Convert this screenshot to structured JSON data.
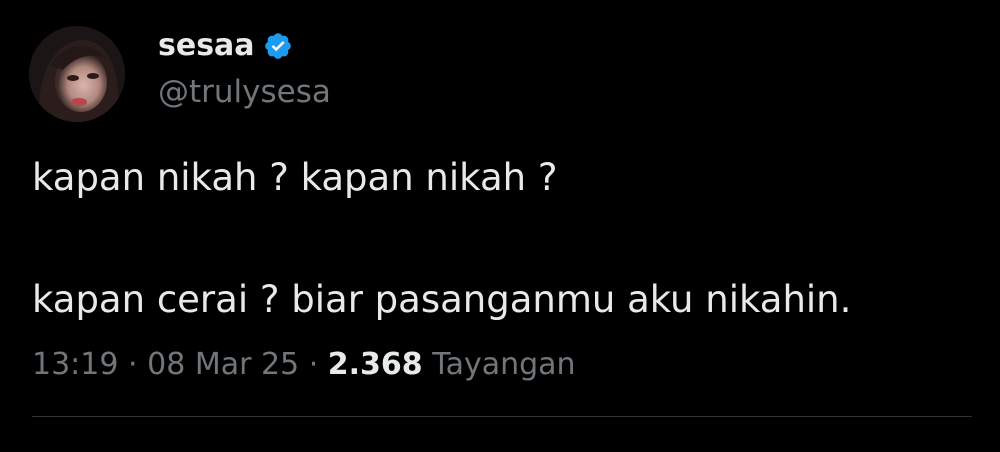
{
  "user": {
    "display_name": "sesaa",
    "handle": "@trulysesa",
    "verified": true
  },
  "tweet": {
    "line1": "kapan nikah ? kapan nikah ?",
    "line2": "kapan cerai ? biar pasanganmu aku nikahin."
  },
  "meta": {
    "time": "13:19",
    "separator": "·",
    "date": "08 Mar 25",
    "views_count": "2.368",
    "views_label": "Tayangan"
  },
  "icons": {
    "verified": "verified-badge-icon"
  },
  "colors": {
    "background": "#000000",
    "text_primary": "#e7e9ea",
    "text_secondary": "#71767b",
    "verified_blue": "#1d9bf0",
    "divider": "#2f3336"
  }
}
